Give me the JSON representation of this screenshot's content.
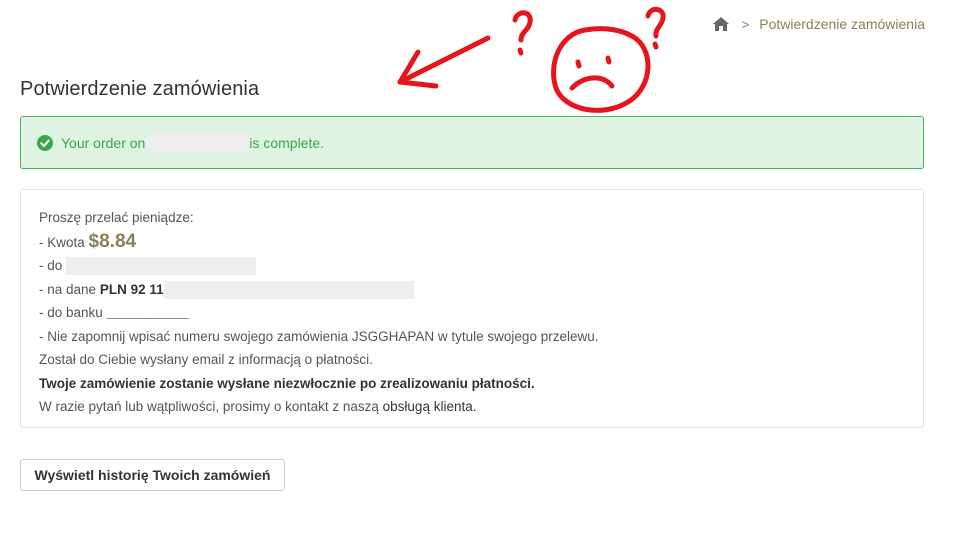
{
  "breadcrumb": {
    "items": [
      "Potwierdzenie zamówienia"
    ]
  },
  "page": {
    "title": "Potwierdzenie zamówienia"
  },
  "alert": {
    "prefix": "Your order on",
    "suffix": "is complete.",
    "color": "#3aa64e"
  },
  "payment": {
    "intro": "Proszę przelać pieniądze:",
    "amount_label": "- Kwota",
    "amount_value": "$8.84",
    "to_label": "- do",
    "account_label": "- na dane",
    "account_value": "PLN 92 11",
    "bank_label": "- do banku",
    "bank_value": "___________",
    "reminder": "- Nie zapomnij wpisać numeru swojego zamówienia JSGGHAPAN w tytule swojego przelewu.",
    "email_notice": "Został do Ciebie wysłany email z informacją o płatności.",
    "ship_notice": "Twoje zamówienie zostanie wysłane niezwłocznie po zrealizowaniu płatności.",
    "contact_prefix": "W razie pytań lub wątpliwości, prosimy o kontakt z naszą",
    "contact_link": "obsługą klienta",
    "contact_suffix": "."
  },
  "actions": {
    "history_button": "Wyświetl historię Twoich zamówień"
  },
  "icons": {
    "breadcrumb_home": "home-icon",
    "alert": "check-circle-icon"
  },
  "colors": {
    "accent": "#8c7f56",
    "alert_bg": "#dff3e2",
    "alert_border": "#47b35a",
    "annotation": "#e8141c"
  }
}
